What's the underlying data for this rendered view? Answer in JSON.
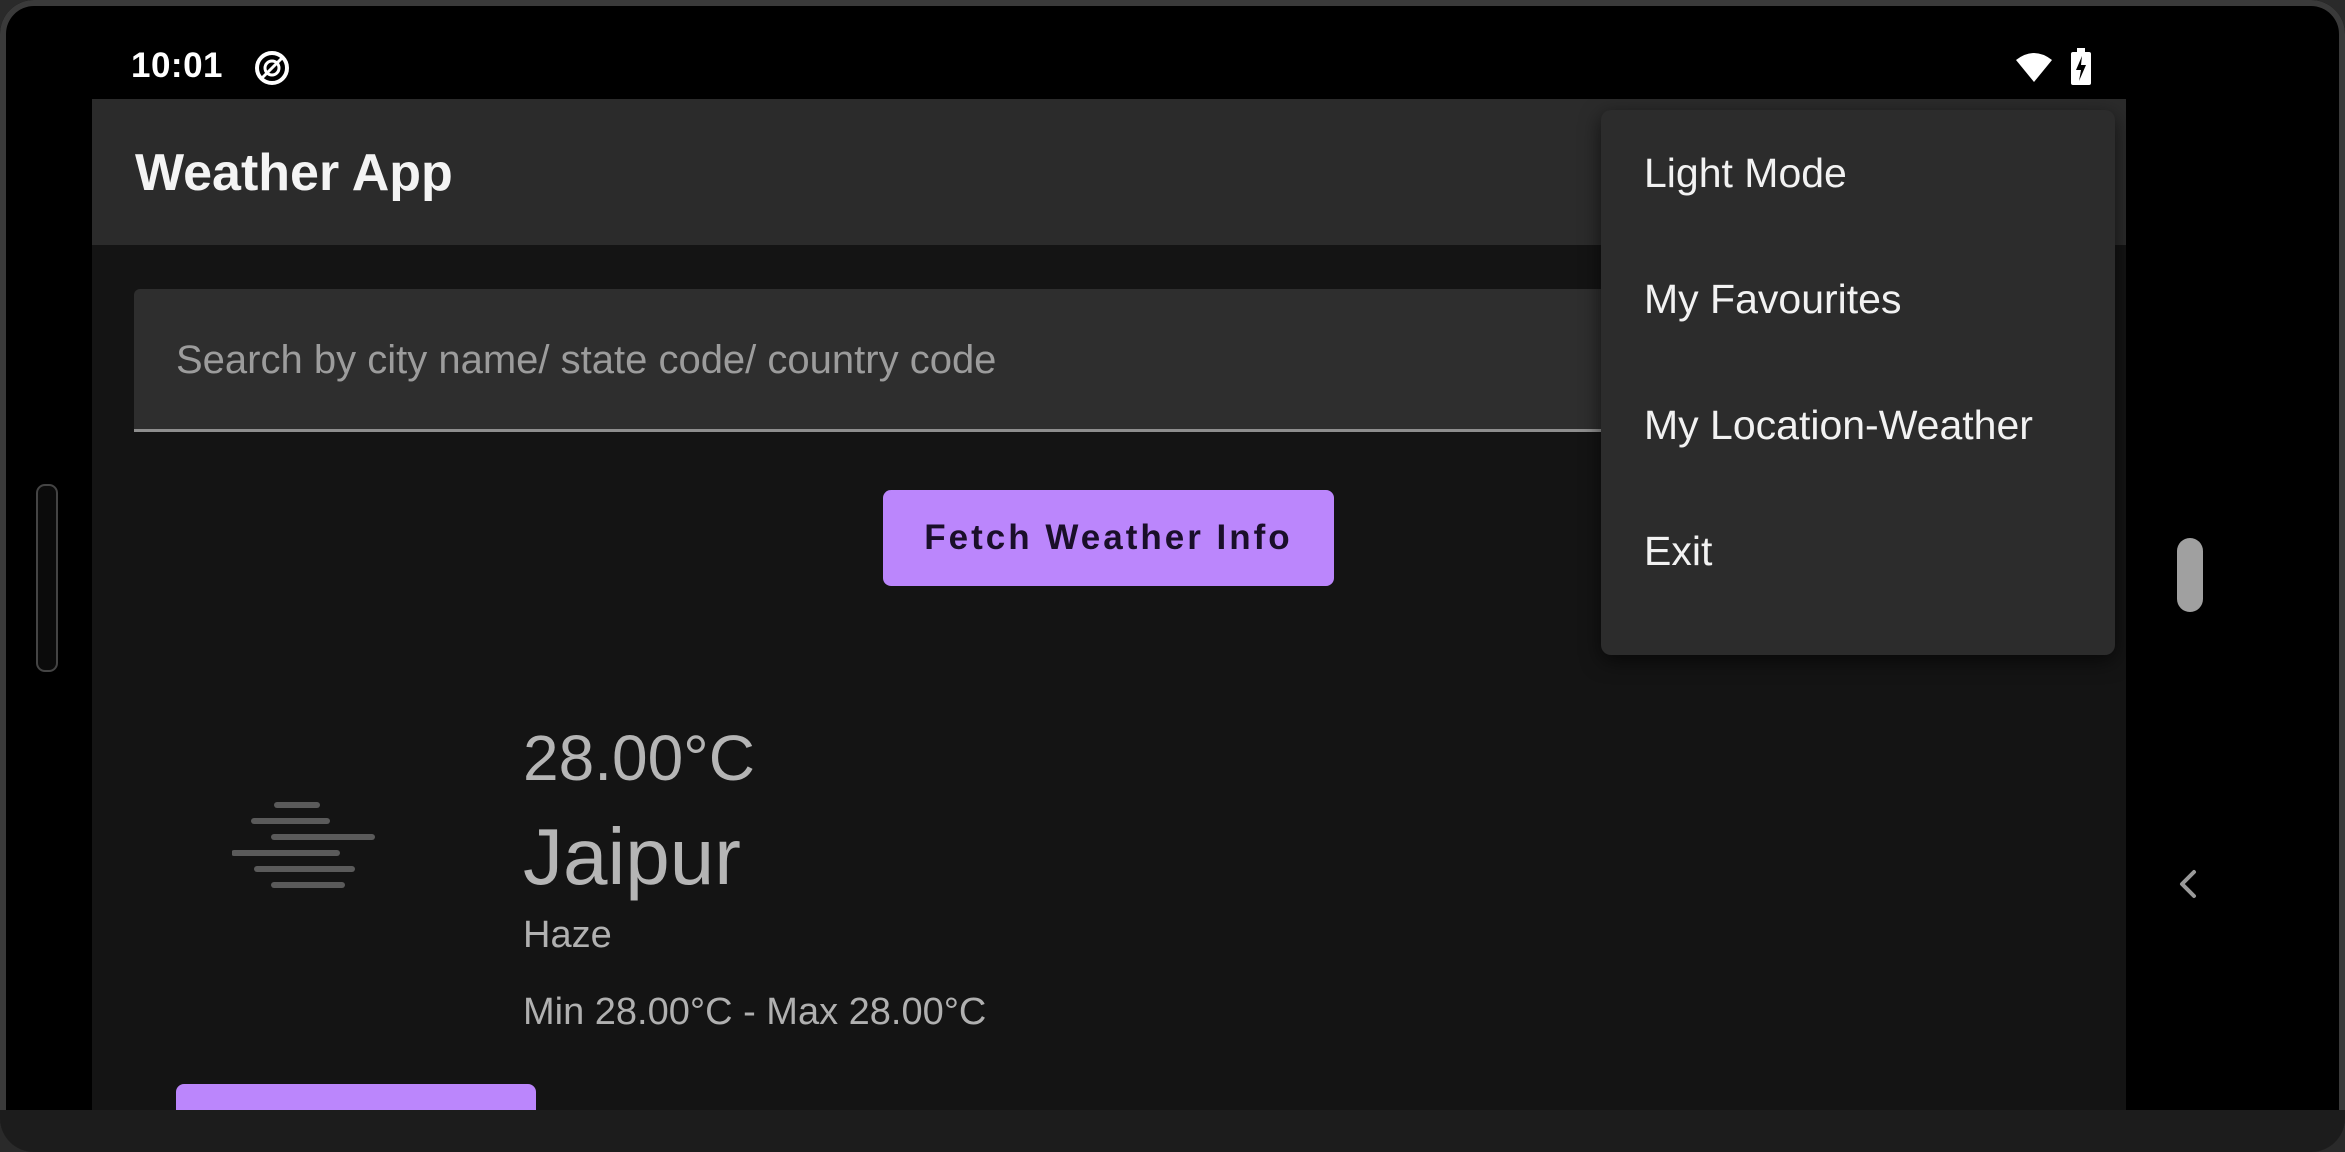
{
  "status_bar": {
    "time": "10:01",
    "left_icon": "data-saver-icon",
    "right_icons": [
      "wifi-icon",
      "battery-charging-icon"
    ]
  },
  "app_bar": {
    "title": "Weather App"
  },
  "search": {
    "placeholder": "Search by city name/ state code/ country code",
    "value": ""
  },
  "actions": {
    "fetch_label": "Fetch Weather Info"
  },
  "weather": {
    "icon": "haze-icon",
    "temperature": "28.00°C",
    "city": "Jaipur",
    "condition": "Haze",
    "min_max": "Min 28.00°C - Max 28.00°C"
  },
  "overflow_menu": {
    "items": [
      {
        "label": "Light Mode"
      },
      {
        "label": "My Favourites"
      },
      {
        "label": "My Location-Weather"
      },
      {
        "label": "Exit"
      }
    ]
  },
  "colors": {
    "accent": "#bb86fc",
    "background": "#141414",
    "app_bar": "#2b2b2b",
    "menu": "#2c2c2c"
  }
}
